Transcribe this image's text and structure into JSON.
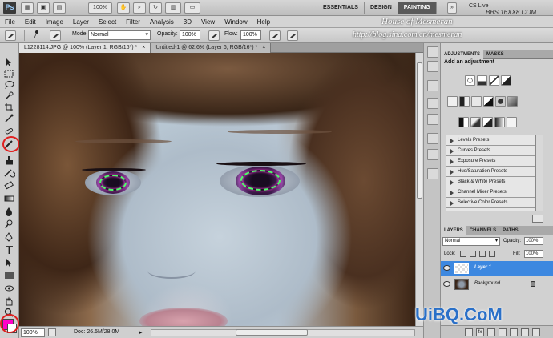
{
  "app": {
    "logo": "Ps",
    "zoom": "100%"
  },
  "workspaces": [
    "ESSENTIALS",
    "DESIGN",
    "PAINTING"
  ],
  "active_workspace": "PAINTING",
  "cs_live": "CS Live",
  "watermarks": {
    "site": "BBS.16XX8.COM",
    "house": "House of Mesmeran",
    "url": "http://blog.sina.com.cn/mesmeran",
    "brand": "UiBQ.CoM"
  },
  "menu": [
    "File",
    "Edit",
    "Image",
    "Layer",
    "Select",
    "Filter",
    "Analysis",
    "3D",
    "View",
    "Window",
    "Help"
  ],
  "options": {
    "brush_size": "7",
    "mode_label": "Mode:",
    "mode_value": "Normal",
    "opacity_label": "Opacity:",
    "opacity_value": "100%",
    "flow_label": "Flow:",
    "flow_value": "100%"
  },
  "tabs": [
    {
      "label": "L1228114.JPG @ 100% (Layer 1, RGB/16*) *",
      "close": "×"
    },
    {
      "label": "Untitled-1 @ 62.6% (Layer 6, RGB/16*) *",
      "close": "×"
    }
  ],
  "status": {
    "zoom": "100%",
    "doc": "Doc: 26.5M/28.0M"
  },
  "colors": {
    "foreground": "#ff00c8",
    "background": "#ffffff",
    "selection": "#3d88e0",
    "highlight": "#e02020"
  },
  "adjustments": {
    "tabs": [
      "ADJUSTMENTS",
      "MASKS"
    ],
    "heading": "Add an adjustment",
    "presets": [
      "Levels Presets",
      "Curves Presets",
      "Exposure Presets",
      "Hue/Saturation Presets",
      "Black & White Presets",
      "Channel Mixer Presets",
      "Selective Color Presets"
    ]
  },
  "layers": {
    "tabs": [
      "LAYERS",
      "CHANNELS",
      "PATHS"
    ],
    "blend_mode": "Normal",
    "opacity_label": "Opacity:",
    "opacity_value": "100%",
    "lock_label": "Lock:",
    "fill_label": "Fill:",
    "fill_value": "100%",
    "items": [
      {
        "name": "Layer 1",
        "selected": true
      },
      {
        "name": "Background",
        "selected": false
      }
    ],
    "footer_icons": [
      "link-icon",
      "fx-icon",
      "mask-icon",
      "adjustment-icon",
      "folder-icon",
      "new-layer-icon",
      "trash-icon"
    ],
    "fx_label": "fx"
  }
}
